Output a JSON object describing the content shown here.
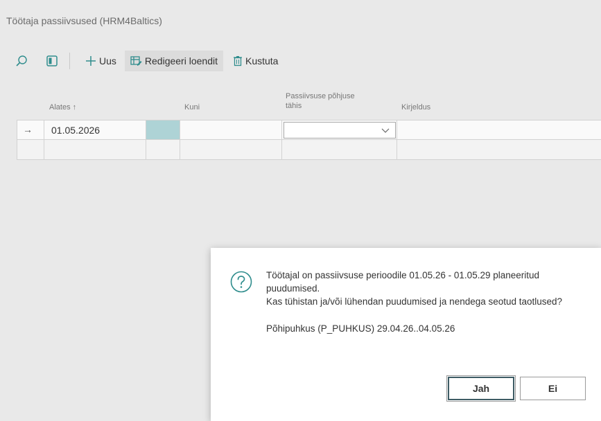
{
  "page": {
    "title": "Töötaja passiivsused (HRM4Baltics)"
  },
  "toolbar": {
    "new_label": "Uus",
    "edit_list_label": "Redigeeri loendit",
    "delete_label": "Kustuta"
  },
  "grid": {
    "columns": {
      "from": "Alates ↑",
      "to": "Kuni",
      "reason_code_line1": "Passiivsuse põhjuse",
      "reason_code_line2": "tähis",
      "description": "Kirjeldus"
    },
    "rows": [
      {
        "from": "01.05.2026",
        "to": "",
        "reason_code": "",
        "description": ""
      },
      {
        "from": "",
        "to": "",
        "reason_code": "",
        "description": ""
      }
    ]
  },
  "dialog": {
    "line1": "Töötajal on passiivsuse perioodile 01.05.26 - 01.05.29 planeeritud puudumised.",
    "line2": "Kas tühistan ja/või lühendan puudumised ja nendega seotud taotlused?",
    "detail": "Põhipuhkus (P_PUHKUS) 29.04.26..04.05.26",
    "yes_label": "Jah",
    "no_label": "Ei"
  },
  "colors": {
    "accent_teal": "#2f8d8d",
    "selected_cell": "#aed3d6"
  }
}
